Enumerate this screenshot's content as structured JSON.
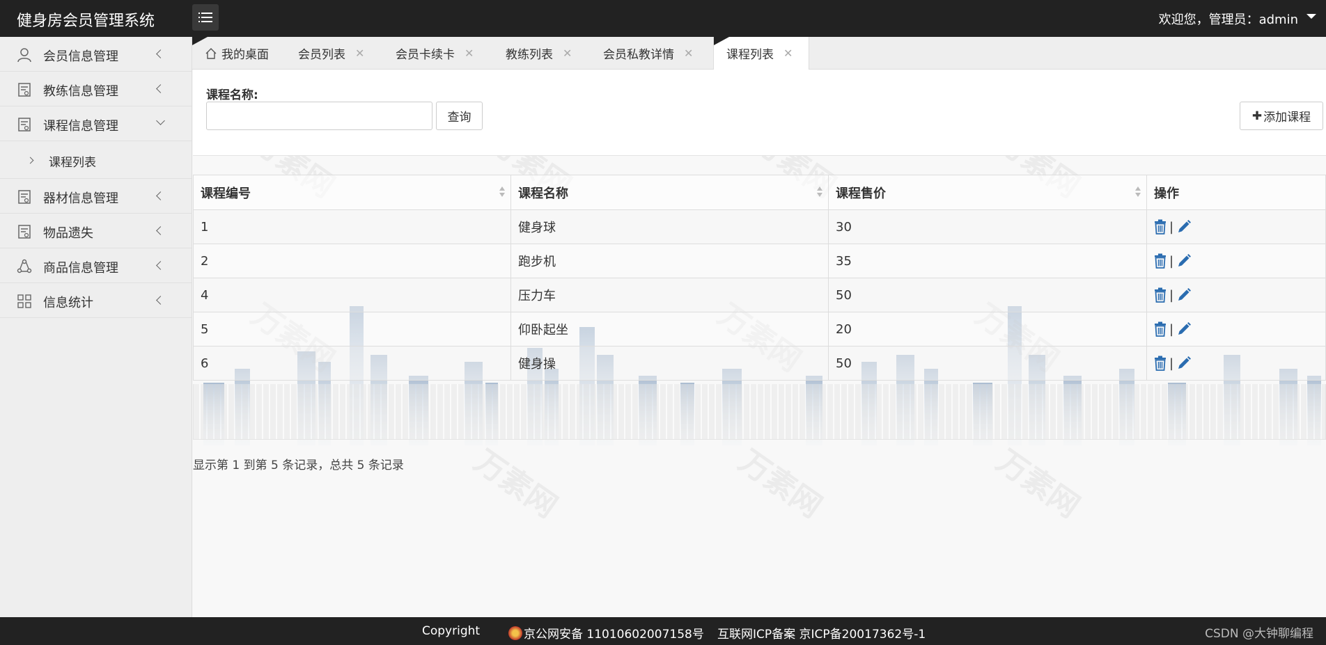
{
  "app": {
    "title": "健身房会员管理系统",
    "welcome": "欢迎您，管理员：admin"
  },
  "sidebar": {
    "items": [
      {
        "label": "会员信息管理",
        "icon": "user-icon"
      },
      {
        "label": "教练信息管理",
        "icon": "document-icon"
      },
      {
        "label": "课程信息管理",
        "icon": "document-icon"
      },
      {
        "label": "器材信息管理",
        "icon": "document-icon"
      },
      {
        "label": "物品遗失",
        "icon": "document-icon"
      },
      {
        "label": "商品信息管理",
        "icon": "recycle-icon"
      },
      {
        "label": "信息统计",
        "icon": "grid-icon"
      }
    ],
    "sub_item": "课程列表"
  },
  "tabs": [
    {
      "label": "我的桌面"
    },
    {
      "label": "会员列表"
    },
    {
      "label": "会员卡续卡"
    },
    {
      "label": "教练列表"
    },
    {
      "label": "会员私教详情"
    },
    {
      "label": "课程列表"
    }
  ],
  "search": {
    "label": "课程名称:",
    "value": "",
    "query_button": "查询",
    "add_button": "添加课程"
  },
  "table": {
    "headers": [
      "课程编号",
      "课程名称",
      "课程售价",
      "操作"
    ],
    "rows": [
      {
        "id": "1",
        "name": "健身球",
        "price": "30"
      },
      {
        "id": "2",
        "name": "跑步机",
        "price": "35"
      },
      {
        "id": "4",
        "name": "压力车",
        "price": "50"
      },
      {
        "id": "5",
        "name": "仰卧起坐",
        "price": "20"
      },
      {
        "id": "6",
        "name": "健身操",
        "price": "50"
      }
    ],
    "separator": "|"
  },
  "pagination": {
    "summary": "显示第 1 到第 5 条记录，总共 5 条记录"
  },
  "footer": {
    "copyright": "Copyright",
    "police": "京公网安备 11010602007158号",
    "icp": "互联网ICP备案 京ICP备20017362号-1",
    "credit": "CSDN @大钟聊编程"
  },
  "colors": {
    "topbar": "#222222",
    "sidebar": "#eeeeee",
    "icon_blue": "#2a6cb0"
  }
}
